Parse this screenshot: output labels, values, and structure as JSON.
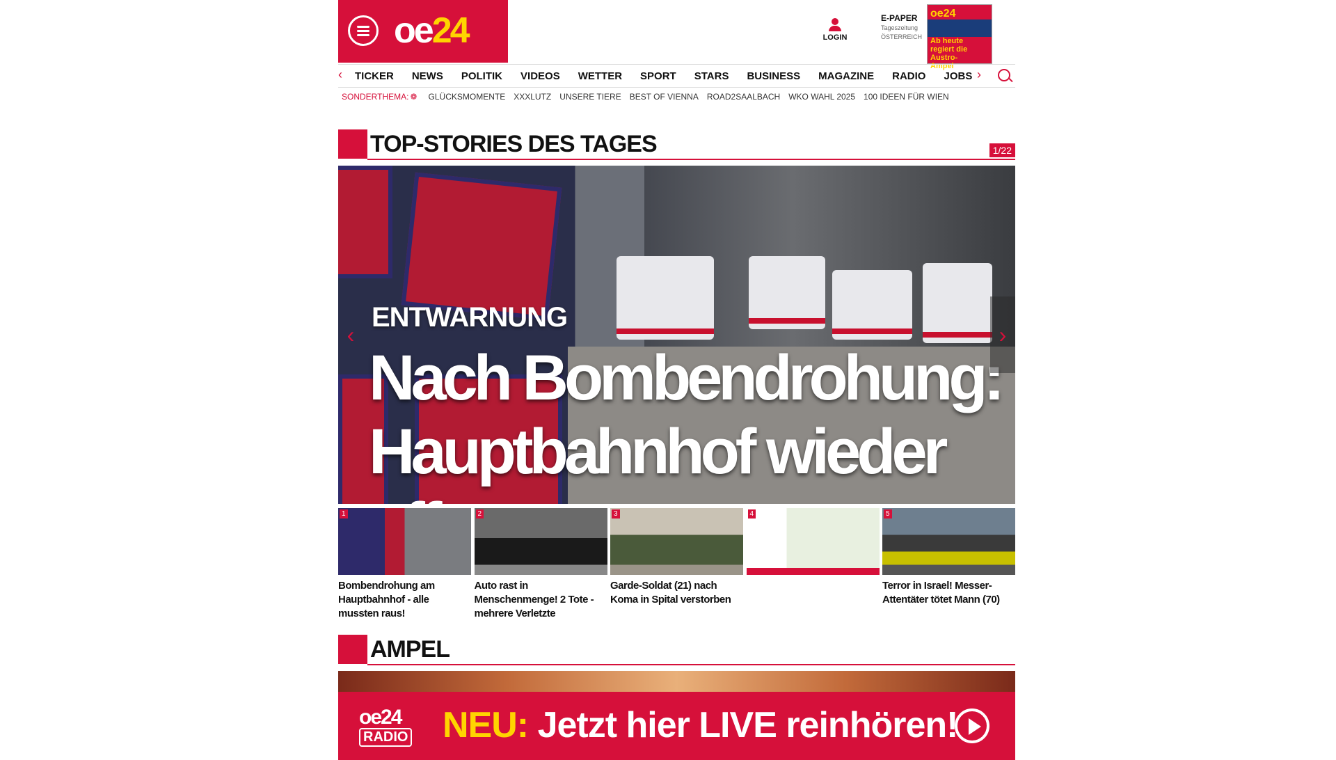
{
  "header": {
    "logo_prefix": "oe",
    "logo_suffix": "24",
    "login_label": "LOGIN",
    "epaper_title": "E-PAPER",
    "epaper_sub1": "Tageszeitung",
    "epaper_sub2": "ÖSTERREICH",
    "epaper_cover_logo": "oe24",
    "epaper_cover_headline": "Ab heute regiert die Austro-Ampel"
  },
  "nav": {
    "items": [
      "TICKER",
      "NEWS",
      "POLITIK",
      "VIDEOS",
      "WETTER",
      "SPORT",
      "STARS",
      "BUSINESS",
      "MAGAZINE",
      "RADIO",
      "JOBS"
    ]
  },
  "sonderthema": {
    "label": "SONDERTHEMA:",
    "items": [
      "GLÜCKSMOMENTE",
      "XXXLUTZ",
      "UNSERE TIERE",
      "BEST OF VIENNA",
      "ROAD2SAALBACH",
      "WKO WAHL 2025",
      "100 IDEEN FÜR WIEN"
    ]
  },
  "topstories": {
    "title": "TOP-STORIES DES TAGES",
    "counter": "1/22",
    "hero": {
      "kicker": "ENTWARNUNG",
      "headline": "Nach Bombendrohung: Hauptbahnhof wieder offen"
    },
    "thumbs": [
      {
        "num": "1",
        "caption": "Bombendrohung am Hauptbahnhof - alle mussten raus!"
      },
      {
        "num": "2",
        "caption": "Auto rast in Menschenmenge! 2 Tote - mehrere Verletzte"
      },
      {
        "num": "3",
        "caption": "Garde-Soldat (21) nach Koma in Spital verstorben"
      },
      {
        "num": "4",
        "caption": ""
      },
      {
        "num": "5",
        "caption": "Terror in Israel! Messer-Attentäter tötet Mann (70)"
      }
    ]
  },
  "ampel": {
    "title": "AMPEL"
  },
  "radio": {
    "logo_top": "oe24",
    "logo_bottom": "RADIO",
    "neu": "NEU:",
    "text": "Jetzt hier LIVE reinhören!"
  },
  "colors": {
    "brand_red": "#d6103a",
    "brand_yellow": "#ffd400"
  }
}
